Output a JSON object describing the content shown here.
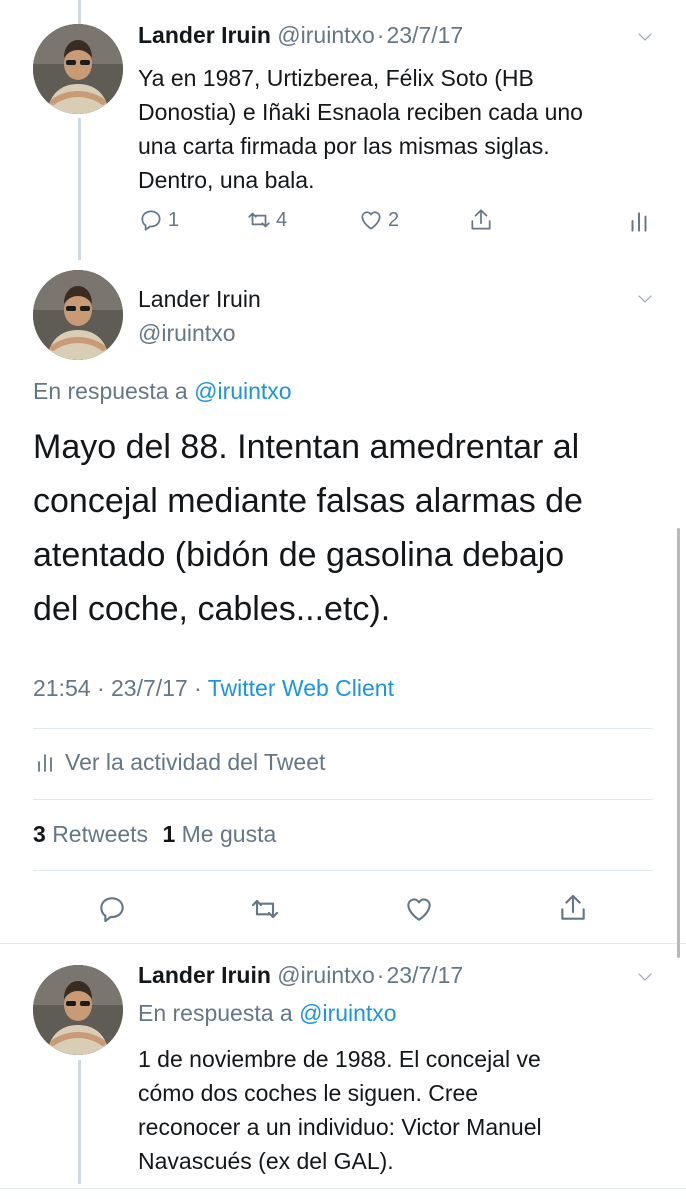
{
  "tweets": [
    {
      "author_name": "Lander Iruin",
      "handle": "@iruintxo",
      "date": "23/7/17",
      "text_lines": [
        "Ya en 1987, Urtizberea, Félix Soto (HB",
        "Donostia) e Iñaki Esnaola reciben cada uno",
        "una carta firmada por las mismas siglas.",
        "Dentro, una bala."
      ],
      "reply_count": "1",
      "retweet_count": "4",
      "like_count": "2"
    },
    {
      "author_name": "Lander Iruin",
      "handle": "@iruintxo",
      "reply_prefix": "En respuesta a",
      "reply_to": "@iruintxo",
      "text_lines": [
        "Mayo del 88. Intentan amedrentar al",
        "concejal mediante falsas alarmas de",
        "atentado (bidón de gasolina debajo",
        "del coche, cables...etc)."
      ],
      "time_date": "21:54 · 23/7/17 ·",
      "source": "Twitter Web Client",
      "activity_label": "Ver la actividad del Tweet",
      "retweets_count": "3",
      "retweets_label": "Retweets",
      "likes_count": "1",
      "likes_label": "Me gusta"
    },
    {
      "author_name": "Lander Iruin",
      "handle": "@iruintxo",
      "date": "23/7/17",
      "reply_prefix": "En respuesta a",
      "reply_to": "@iruintxo",
      "text_lines": [
        "1 de noviembre de 1988. El concejal ve",
        "cómo dos coches le siguen. Cree",
        "reconocer a un individuo: Victor Manuel",
        "Navascués (ex del GAL)."
      ]
    }
  ],
  "separator": "·",
  "colors": {
    "link": "#1b95e0",
    "muted": "#657786",
    "text": "#14171a"
  },
  "icons": [
    "chevron-down-icon",
    "reply-icon",
    "retweet-icon",
    "like-icon",
    "share-icon",
    "analytics-icon",
    "avatar"
  ]
}
